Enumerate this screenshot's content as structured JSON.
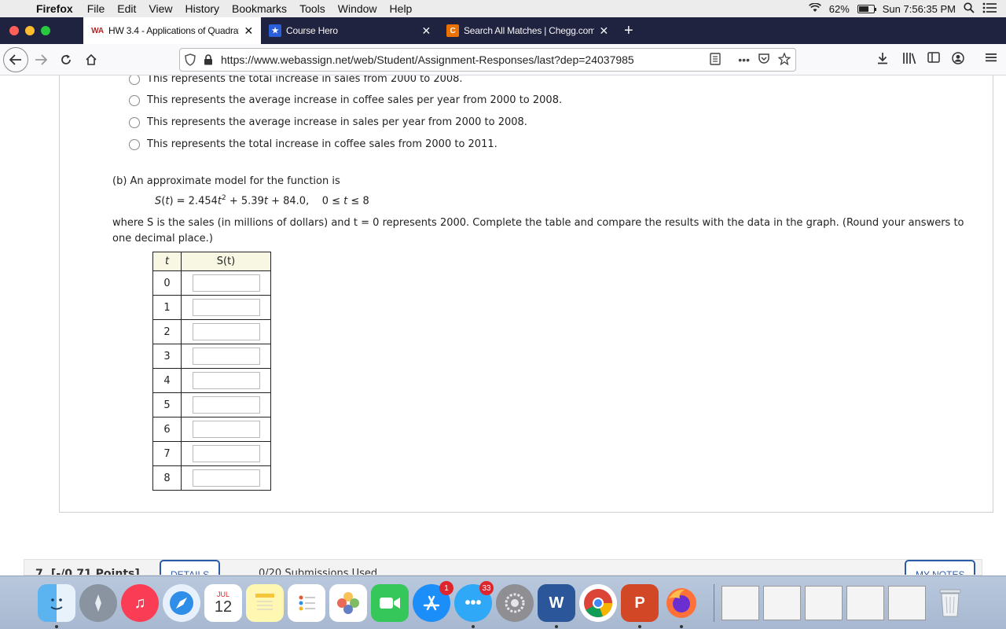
{
  "menubar": {
    "app_name": "Firefox",
    "menus": [
      "File",
      "Edit",
      "View",
      "History",
      "Bookmarks",
      "Tools",
      "Window",
      "Help"
    ],
    "battery": "62%",
    "clock": "Sun 7:56:35 PM"
  },
  "tabs": [
    {
      "title": "HW 3.4 - Applications of Quadrat",
      "favicon": "WA",
      "active": true
    },
    {
      "title": "Course Hero",
      "favicon": "★",
      "active": false
    },
    {
      "title": "Search All Matches | Chegg.com",
      "favicon": "C",
      "active": false
    }
  ],
  "navbar": {
    "url": "https://www.webassign.net/web/Student/Assignment-Responses/last?dep=24037985"
  },
  "options": [
    "This represents the total increase in sales from 2000 to 2008.",
    "This represents the average increase in coffee sales per year from 2000 to 2008.",
    "This represents the average increase in sales per year from 2000 to 2008.",
    "This represents the total increase in coffee sales from 2000 to 2011."
  ],
  "part_b": {
    "intro": "(b) An approximate model for the function is",
    "instructions_line1": "where S is the sales (in millions of dollars) and t = 0 represents 2000. Complete the table and compare the results with the data in the graph. (Round your answers to",
    "instructions_line2": "one decimal place.)"
  },
  "table": {
    "header_t": "t",
    "header_s": "S(t)",
    "rows": [
      "0",
      "1",
      "2",
      "3",
      "4",
      "5",
      "6",
      "7",
      "8"
    ]
  },
  "next_question": {
    "label": "7. [-/0.71 Points]",
    "details_button": "DETAILS",
    "submissions": "0/20 Submissions Used",
    "notes_button": "MY NOTES"
  },
  "dock": {
    "calendar_month": "JUL",
    "calendar_day": "12",
    "appstore_badge": "1",
    "messages_badge": "33"
  }
}
